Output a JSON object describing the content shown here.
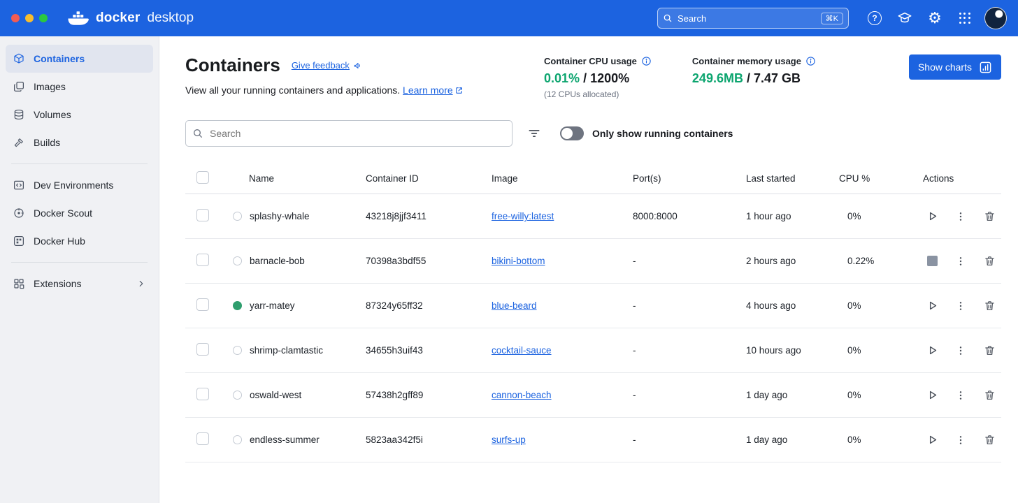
{
  "colors": {
    "header_blue": "#1C63E0",
    "accent_blue": "#1C63E0",
    "value_green": "#0CA56F",
    "running_green": "#2F9E6E"
  },
  "titlebar": {
    "brand_bold": "docker",
    "brand_light": "desktop",
    "search_placeholder": "Search",
    "search_shortcut": "⌘K"
  },
  "sidebar": {
    "items": [
      {
        "label": "Containers",
        "icon": "containers-icon",
        "active": true
      },
      {
        "label": "Images",
        "icon": "images-icon"
      },
      {
        "label": "Volumes",
        "icon": "volumes-icon"
      },
      {
        "label": "Builds",
        "icon": "builds-icon"
      },
      {
        "label": "Dev Environments",
        "icon": "dev-environments-icon"
      },
      {
        "label": "Docker Scout",
        "icon": "docker-scout-icon"
      },
      {
        "label": "Docker Hub",
        "icon": "docker-hub-icon"
      },
      {
        "label": "Extensions",
        "icon": "extensions-icon"
      }
    ]
  },
  "header": {
    "title": "Containers",
    "feedback_label": "Give feedback",
    "subtitle": "View all your running containers and applications.",
    "learn_more_label": "Learn more",
    "cpu": {
      "label": "Container CPU usage",
      "value": "0.01%",
      "total": "/ 1200%",
      "note": "(12 CPUs allocated)"
    },
    "memory": {
      "label": "Container memory usage",
      "value": "249.6MB",
      "total": "/ 7.47 GB"
    },
    "show_charts_label": "Show charts"
  },
  "toolbar": {
    "search_placeholder": "Search",
    "toggle_label": "Only show running containers"
  },
  "table": {
    "columns": [
      "Name",
      "Container ID",
      "Image",
      "Port(s)",
      "Last started",
      "CPU %",
      "Actions"
    ],
    "rows": [
      {
        "name": "splashy-whale",
        "id": "43218j8jjf3411",
        "image": "free-willy:latest",
        "ports": "8000:8000",
        "last_started": "1 hour ago",
        "cpu": "0%",
        "running": false,
        "action": "play"
      },
      {
        "name": "barnacle-bob",
        "id": "70398a3bdf55",
        "image": "bikini-bottom",
        "ports": "-",
        "last_started": "2 hours ago",
        "cpu": "0.22%",
        "running": false,
        "action": "stop"
      },
      {
        "name": "yarr-matey",
        "id": "87324y65ff32",
        "image": "blue-beard",
        "ports": "-",
        "last_started": "4 hours ago",
        "cpu": "0%",
        "running": true,
        "action": "play"
      },
      {
        "name": "shrimp-clamtastic",
        "id": "34655h3uif43",
        "image": "cocktail-sauce",
        "ports": "-",
        "last_started": "10 hours ago",
        "cpu": "0%",
        "running": false,
        "action": "play"
      },
      {
        "name": "oswald-west",
        "id": "57438h2gff89",
        "image": "cannon-beach",
        "ports": "-",
        "last_started": "1 day ago",
        "cpu": "0%",
        "running": false,
        "action": "play"
      },
      {
        "name": "endless-summer",
        "id": "5823aa342f5i",
        "image": "surfs-up",
        "ports": "-",
        "last_started": "1 day ago",
        "cpu": "0%",
        "running": false,
        "action": "play"
      }
    ]
  }
}
